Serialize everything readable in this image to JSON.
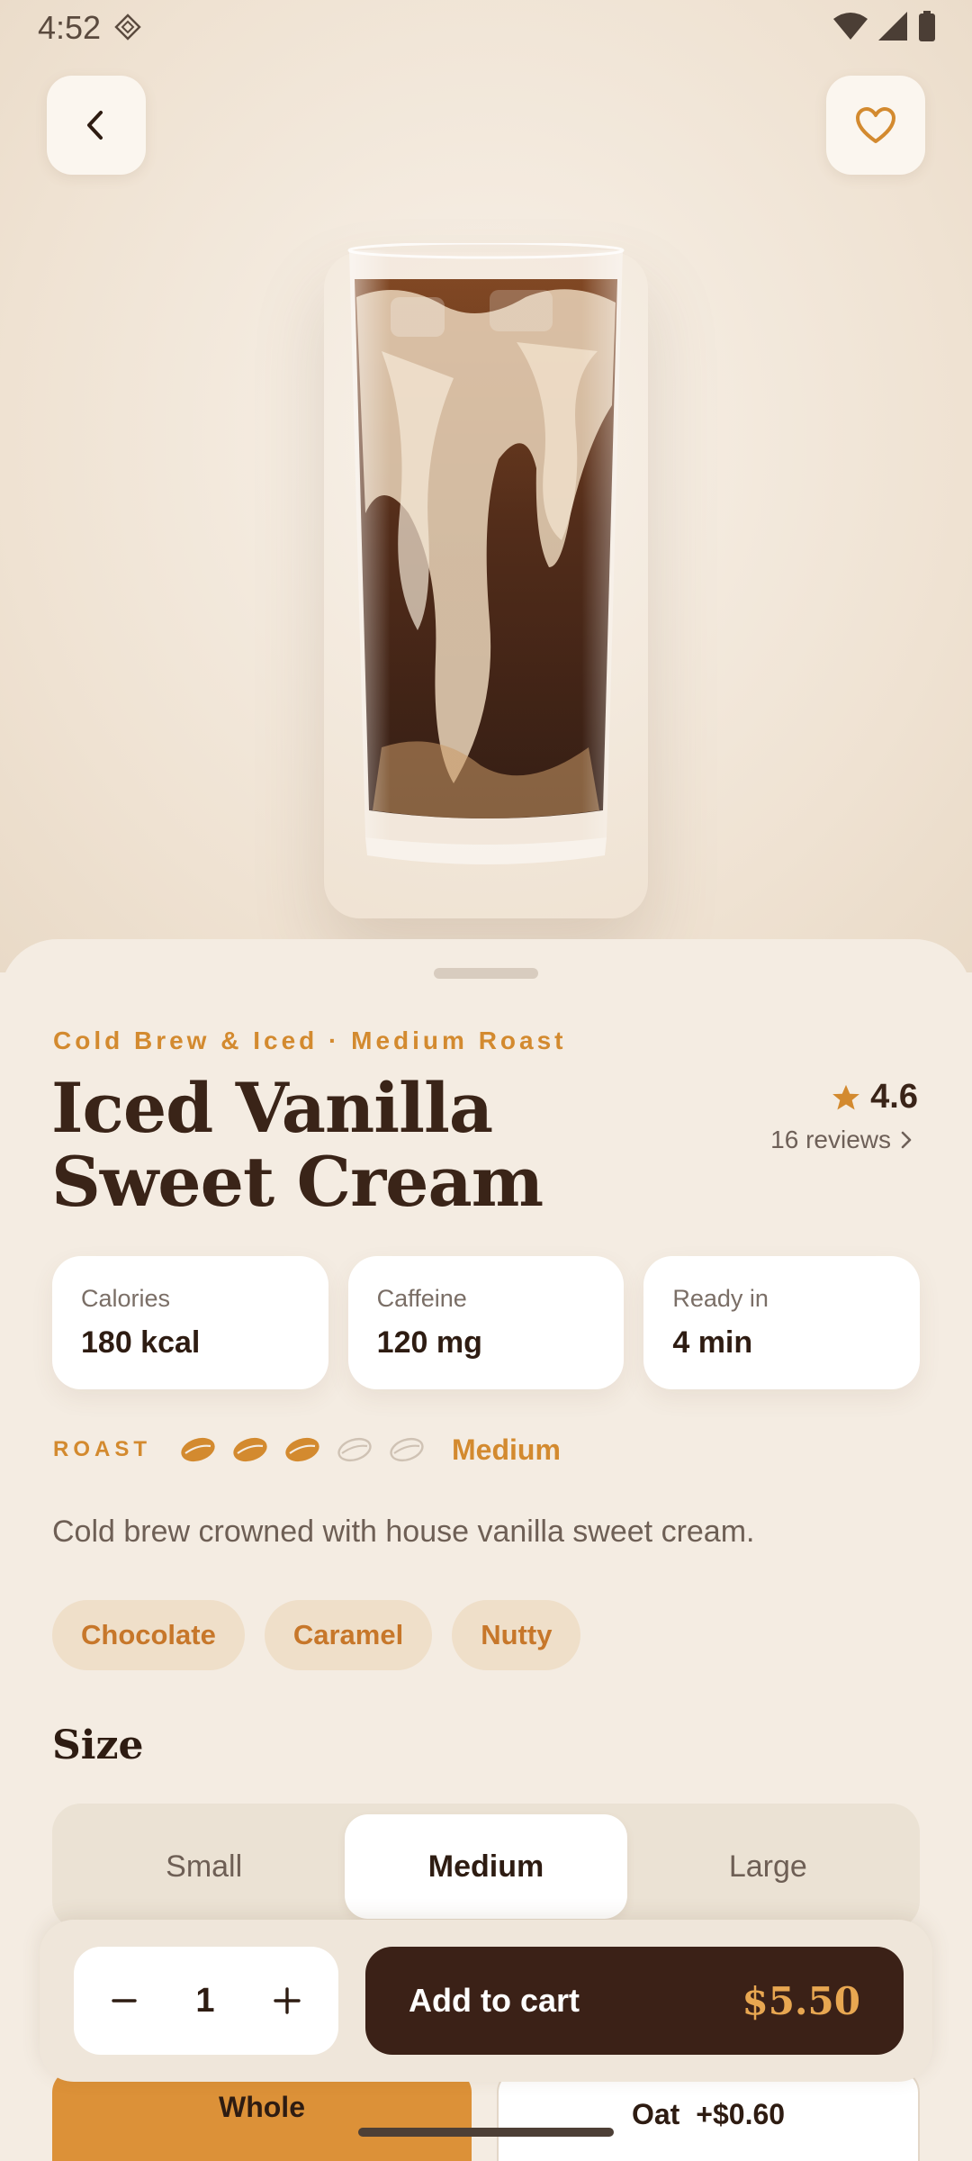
{
  "status": {
    "time": "4:52"
  },
  "product": {
    "category": "Cold Brew & Iced · Medium Roast",
    "name": "Iced Vanilla Sweet Cream",
    "rating": "4.6",
    "reviews": "16 reviews",
    "description": "Cold brew crowned with house vanilla sweet cream."
  },
  "stats": [
    {
      "label": "Calories",
      "value": "180 kcal"
    },
    {
      "label": "Caffeine",
      "value": "120 mg"
    },
    {
      "label": "Ready in",
      "value": "4 min"
    }
  ],
  "roast": {
    "label": "ROAST",
    "level_text": "Medium",
    "level": 3,
    "max": 5
  },
  "tags": [
    "Chocolate",
    "Caramel",
    "Nutty"
  ],
  "size": {
    "title": "Size",
    "options": [
      "Small",
      "Medium",
      "Large"
    ],
    "selected": "Medium"
  },
  "milk": {
    "options": [
      {
        "label": "Whole",
        "price": ""
      },
      {
        "label": "Oat",
        "price": "+$0.60"
      }
    ],
    "selected": "Whole"
  },
  "cart": {
    "quantity": "1",
    "add_label": "Add to cart",
    "price": "$5.50"
  },
  "colors": {
    "accent": "#d38a2f",
    "dark": "#3b2117",
    "background": "#f4ece2"
  },
  "icons": {
    "back": "chevron-left-icon",
    "favorite": "heart-icon",
    "star": "star-icon",
    "minus": "minus-icon",
    "plus": "plus-icon"
  }
}
